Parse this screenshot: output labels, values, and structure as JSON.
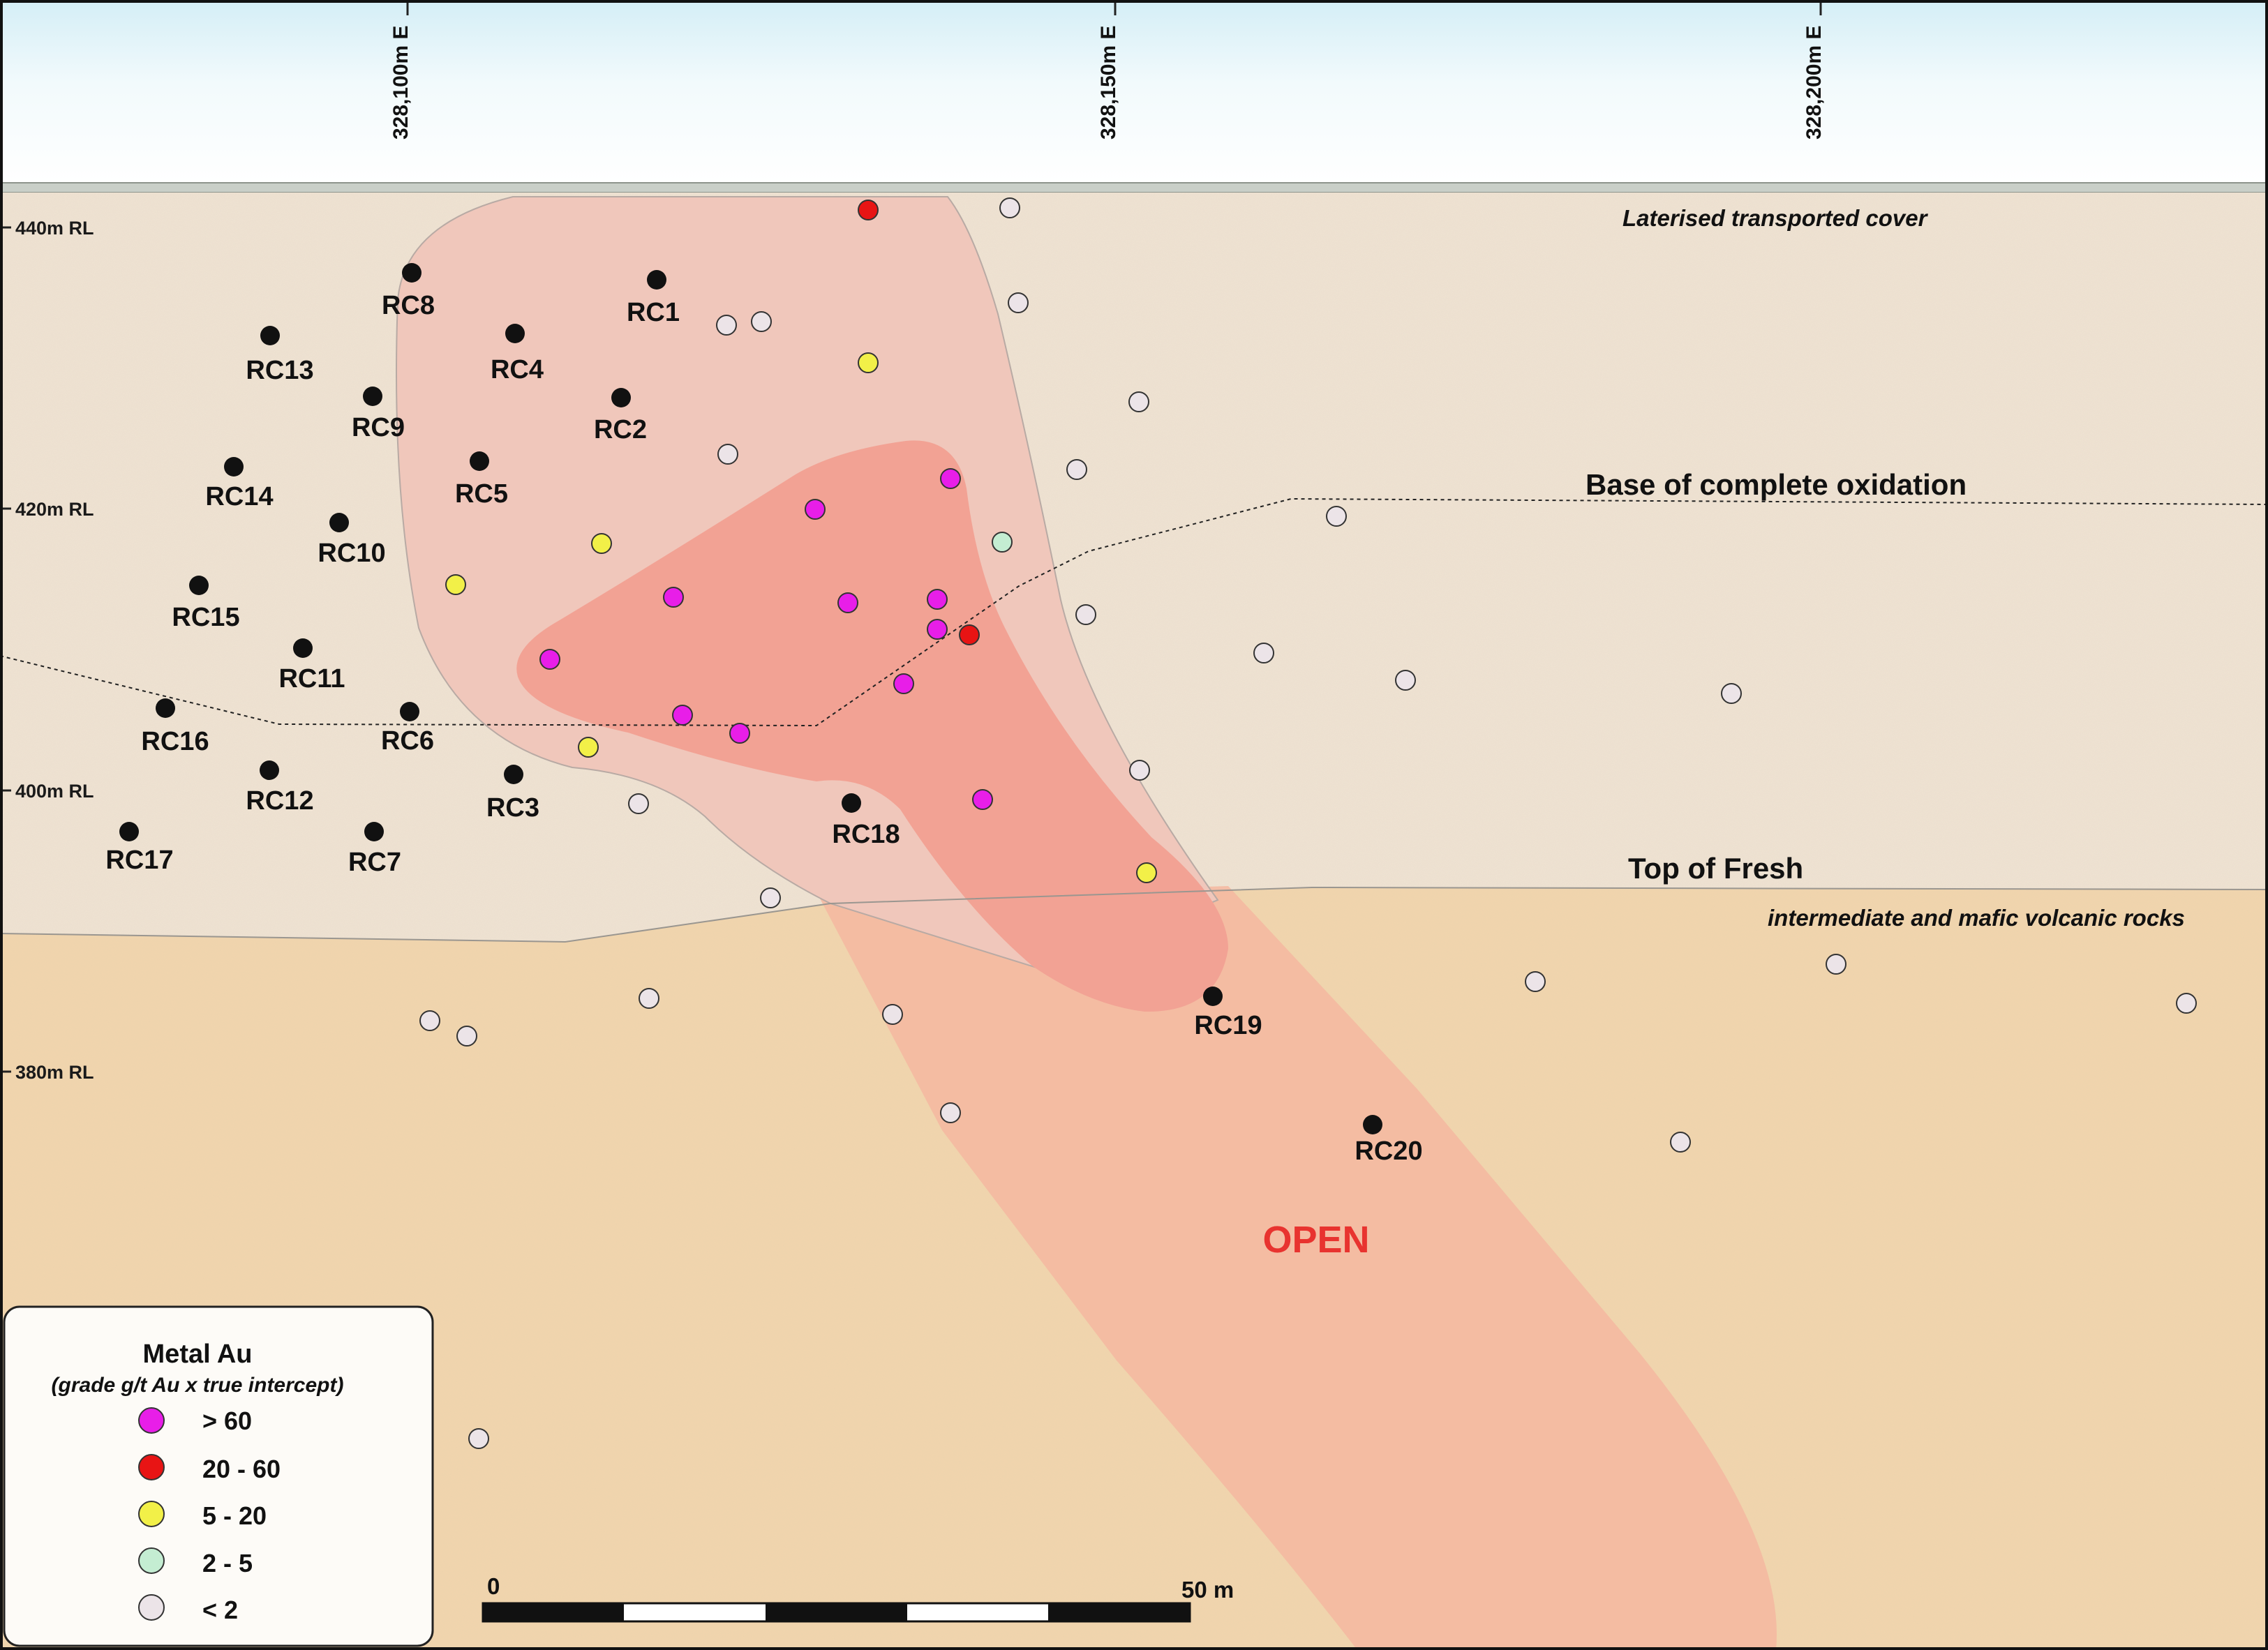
{
  "eastings": [
    "328,100m E",
    "328,150m E",
    "328,200m E"
  ],
  "rl_labels": [
    "440m RL",
    "420m RL",
    "400m RL",
    "380m RL"
  ],
  "units": {
    "cover": "Laterised transported cover",
    "fresh_rocks": "intermediate and mafic volcanic rocks"
  },
  "contacts": {
    "base_oxidation": "Base of complete oxidation",
    "top_fresh": "Top of Fresh"
  },
  "open_label": "OPEN",
  "scale_bar": {
    "start_label": "0",
    "end_label": "50 m"
  },
  "legend": {
    "title": "Metal Au",
    "subtitle": "(grade g/t Au x true intercept)",
    "classes": [
      {
        "label": "> 60",
        "color": "#e81ee8"
      },
      {
        "label": "20 - 60",
        "color": "#e81414"
      },
      {
        "label": "5 - 20",
        "color": "#f2f048"
      },
      {
        "label": "2 - 5",
        "color": "#c4edd2"
      },
      {
        "label": "< 2",
        "color": "#ece4e8"
      }
    ]
  },
  "colors": {
    "cover_fill": "#efe3d3",
    "fresh_fill": "#f2d6ae",
    "halo_fill": "#f0c7bb",
    "core_fill": "#f2a294",
    "open_fill": "#f5b7a0",
    "hole_marker": "#111111",
    "open_text": "#e8332f"
  },
  "drill_holes": [
    "RC1",
    "RC2",
    "RC3",
    "RC4",
    "RC5",
    "RC6",
    "RC7",
    "RC8",
    "RC9",
    "RC10",
    "RC11",
    "RC12",
    "RC13",
    "RC14",
    "RC15",
    "RC16",
    "RC17",
    "RC18",
    "RC19",
    "RC20"
  ]
}
